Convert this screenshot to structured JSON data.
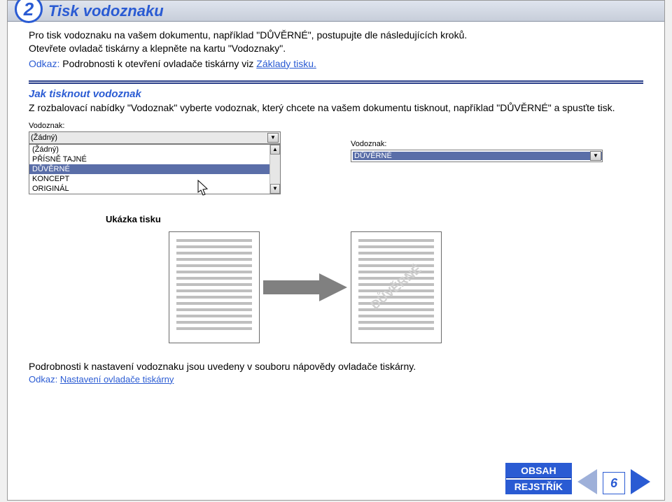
{
  "section_number": "2",
  "section_title": "Tisk vodoznaku",
  "intro_line1": "Pro tisk vodoznaku na vašem dokumentu, například \"DŮVĚRNÉ\", postupujte dle následujících kroků.",
  "intro_line2": "Otevřete ovladač tiskárny a klepněte na kartu \"Vodoznaky\".",
  "odkaz1_label": "Odkaz:",
  "odkaz1_text": "Podrobnosti k otevření ovladače tiskárny viz ",
  "odkaz1_link": "Základy tisku.",
  "sub_heading": "Jak tisknout vodoznak",
  "sub_text": "Z rozbalovací nabídky \"Vodoznak\" vyberte vodoznak, který chcete na vašem dokumentu tisknout, například \"DŮVĚRNÉ\" a spusťte tisk.",
  "dropdown_left": {
    "label": "Vodoznak:",
    "value": "(Žádný)",
    "options": [
      "(Žádný)",
      "PŘÍSNĚ TAJNÉ",
      "DŮVĚRNÉ",
      "KONCEPT",
      "ORIGINÁL"
    ],
    "selected_index": 2
  },
  "dropdown_right": {
    "label": "Vodoznak:",
    "value": "DŮVĚRNÉ"
  },
  "preview_label": "Ukázka tisku",
  "watermark_text": "DŮVĚRNÉ",
  "bottom_note": "Podrobnosti k nastavení vodoznaku jsou uvedeny v souboru nápovědy ovladače tiskárny.",
  "odkaz2_label": "Odkaz:",
  "odkaz2_link": "Nastavení ovladače tiskárny",
  "nav": {
    "obsah": "OBSAH",
    "rejstrik": "REJSTŘÍK",
    "page": "6"
  }
}
